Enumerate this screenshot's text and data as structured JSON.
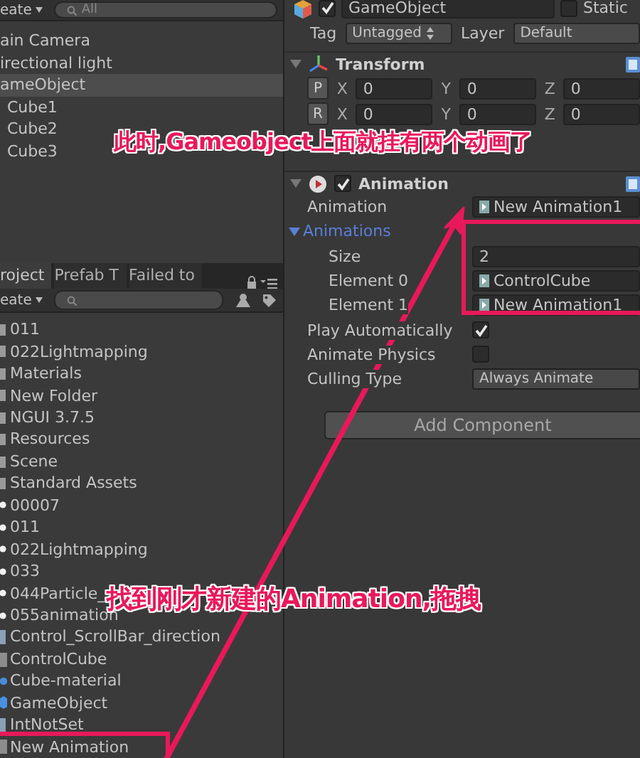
{
  "hierarchy": {
    "create": "eate",
    "search": "All",
    "items": [
      {
        "label": "ain Camera",
        "selected": false
      },
      {
        "label": "irectional light",
        "selected": false
      },
      {
        "label": "ameObject",
        "selected": true,
        "children": [
          {
            "label": "Cube1",
            "selected": false
          },
          {
            "label": "Cube2",
            "selected": false
          },
          {
            "label": "Cube3",
            "selected": false
          }
        ]
      }
    ]
  },
  "project": {
    "tabs": [
      {
        "label": "roject",
        "selected": true
      },
      {
        "label": "Prefab T",
        "selected": false
      },
      {
        "label": "Failed to",
        "selected": false
      }
    ],
    "create": "eate",
    "items": [
      {
        "label": "011",
        "kind": "folder"
      },
      {
        "label": "022Lightmapping",
        "kind": "folder"
      },
      {
        "label": "Materials",
        "kind": "folder"
      },
      {
        "label": "New Folder",
        "kind": "folder"
      },
      {
        "label": "NGUI 3.7.5",
        "kind": "folder"
      },
      {
        "label": "Resources",
        "kind": "folder"
      },
      {
        "label": "Scene",
        "kind": "folder"
      },
      {
        "label": "Standard Assets",
        "kind": "folder"
      },
      {
        "label": "00007",
        "kind": "scene"
      },
      {
        "label": "011",
        "kind": "scene"
      },
      {
        "label": "022Lightmapping",
        "kind": "scene"
      },
      {
        "label": "033",
        "kind": "scene"
      },
      {
        "label": "044Particle_",
        "kind": "scene"
      },
      {
        "label": "055animation",
        "kind": "scene"
      },
      {
        "label": "Control_ScrollBar_direction",
        "kind": "script"
      },
      {
        "label": "ControlCube",
        "kind": "clip"
      },
      {
        "label": "Cube-material",
        "kind": "material"
      },
      {
        "label": "GameObject",
        "kind": "prefab"
      },
      {
        "label": "IntNotSet",
        "kind": "script"
      },
      {
        "label": "New Animation",
        "kind": "clip"
      }
    ]
  },
  "inspector": {
    "object": {
      "active": true,
      "name": "GameObject",
      "static": false,
      "static_label": "Static",
      "tag_label": "Tag",
      "tag": "Untagged",
      "layer_label": "Layer",
      "layer": "Default"
    },
    "components": [
      {
        "kind": "transform",
        "title": "Transform",
        "rows": [
          {
            "button": "P",
            "fields": [
              {
                "axis": "X",
                "value": "0"
              },
              {
                "axis": "Y",
                "value": "0"
              },
              {
                "axis": "Z",
                "value": "0"
              }
            ]
          },
          {
            "button": "R",
            "fields": [
              {
                "axis": "X",
                "value": "0"
              },
              {
                "axis": "Y",
                "value": "0"
              },
              {
                "axis": "Z",
                "value": "0"
              }
            ]
          }
        ]
      },
      {
        "kind": "animation",
        "title": "Animation",
        "enabled": true,
        "properties": [
          {
            "kind": "object",
            "label": "Animation",
            "value": "New Animation1"
          },
          {
            "kind": "foldout",
            "label": "Animations",
            "expanded": true,
            "children": [
              {
                "kind": "number",
                "label": "Size",
                "value": "2"
              },
              {
                "kind": "object",
                "label": "Element 0",
                "value": "ControlCube"
              },
              {
                "kind": "object",
                "label": "Element 1",
                "value": "New Animation1"
              }
            ]
          },
          {
            "kind": "checkbox",
            "label": "Play Automatically",
            "checked": true
          },
          {
            "kind": "checkbox",
            "label": "Animate Physics",
            "checked": false
          },
          {
            "kind": "dropdown",
            "label": "Culling Type",
            "value": "Always Animate"
          }
        ]
      }
    ],
    "add_component": "Add Component"
  },
  "annotations": [
    {
      "kind": "top",
      "text": "此时,Gameobject上面就挂有两个动画了"
    },
    {
      "kind": "bottom",
      "text": "找到刚才新建的Animation,拖拽"
    }
  ]
}
